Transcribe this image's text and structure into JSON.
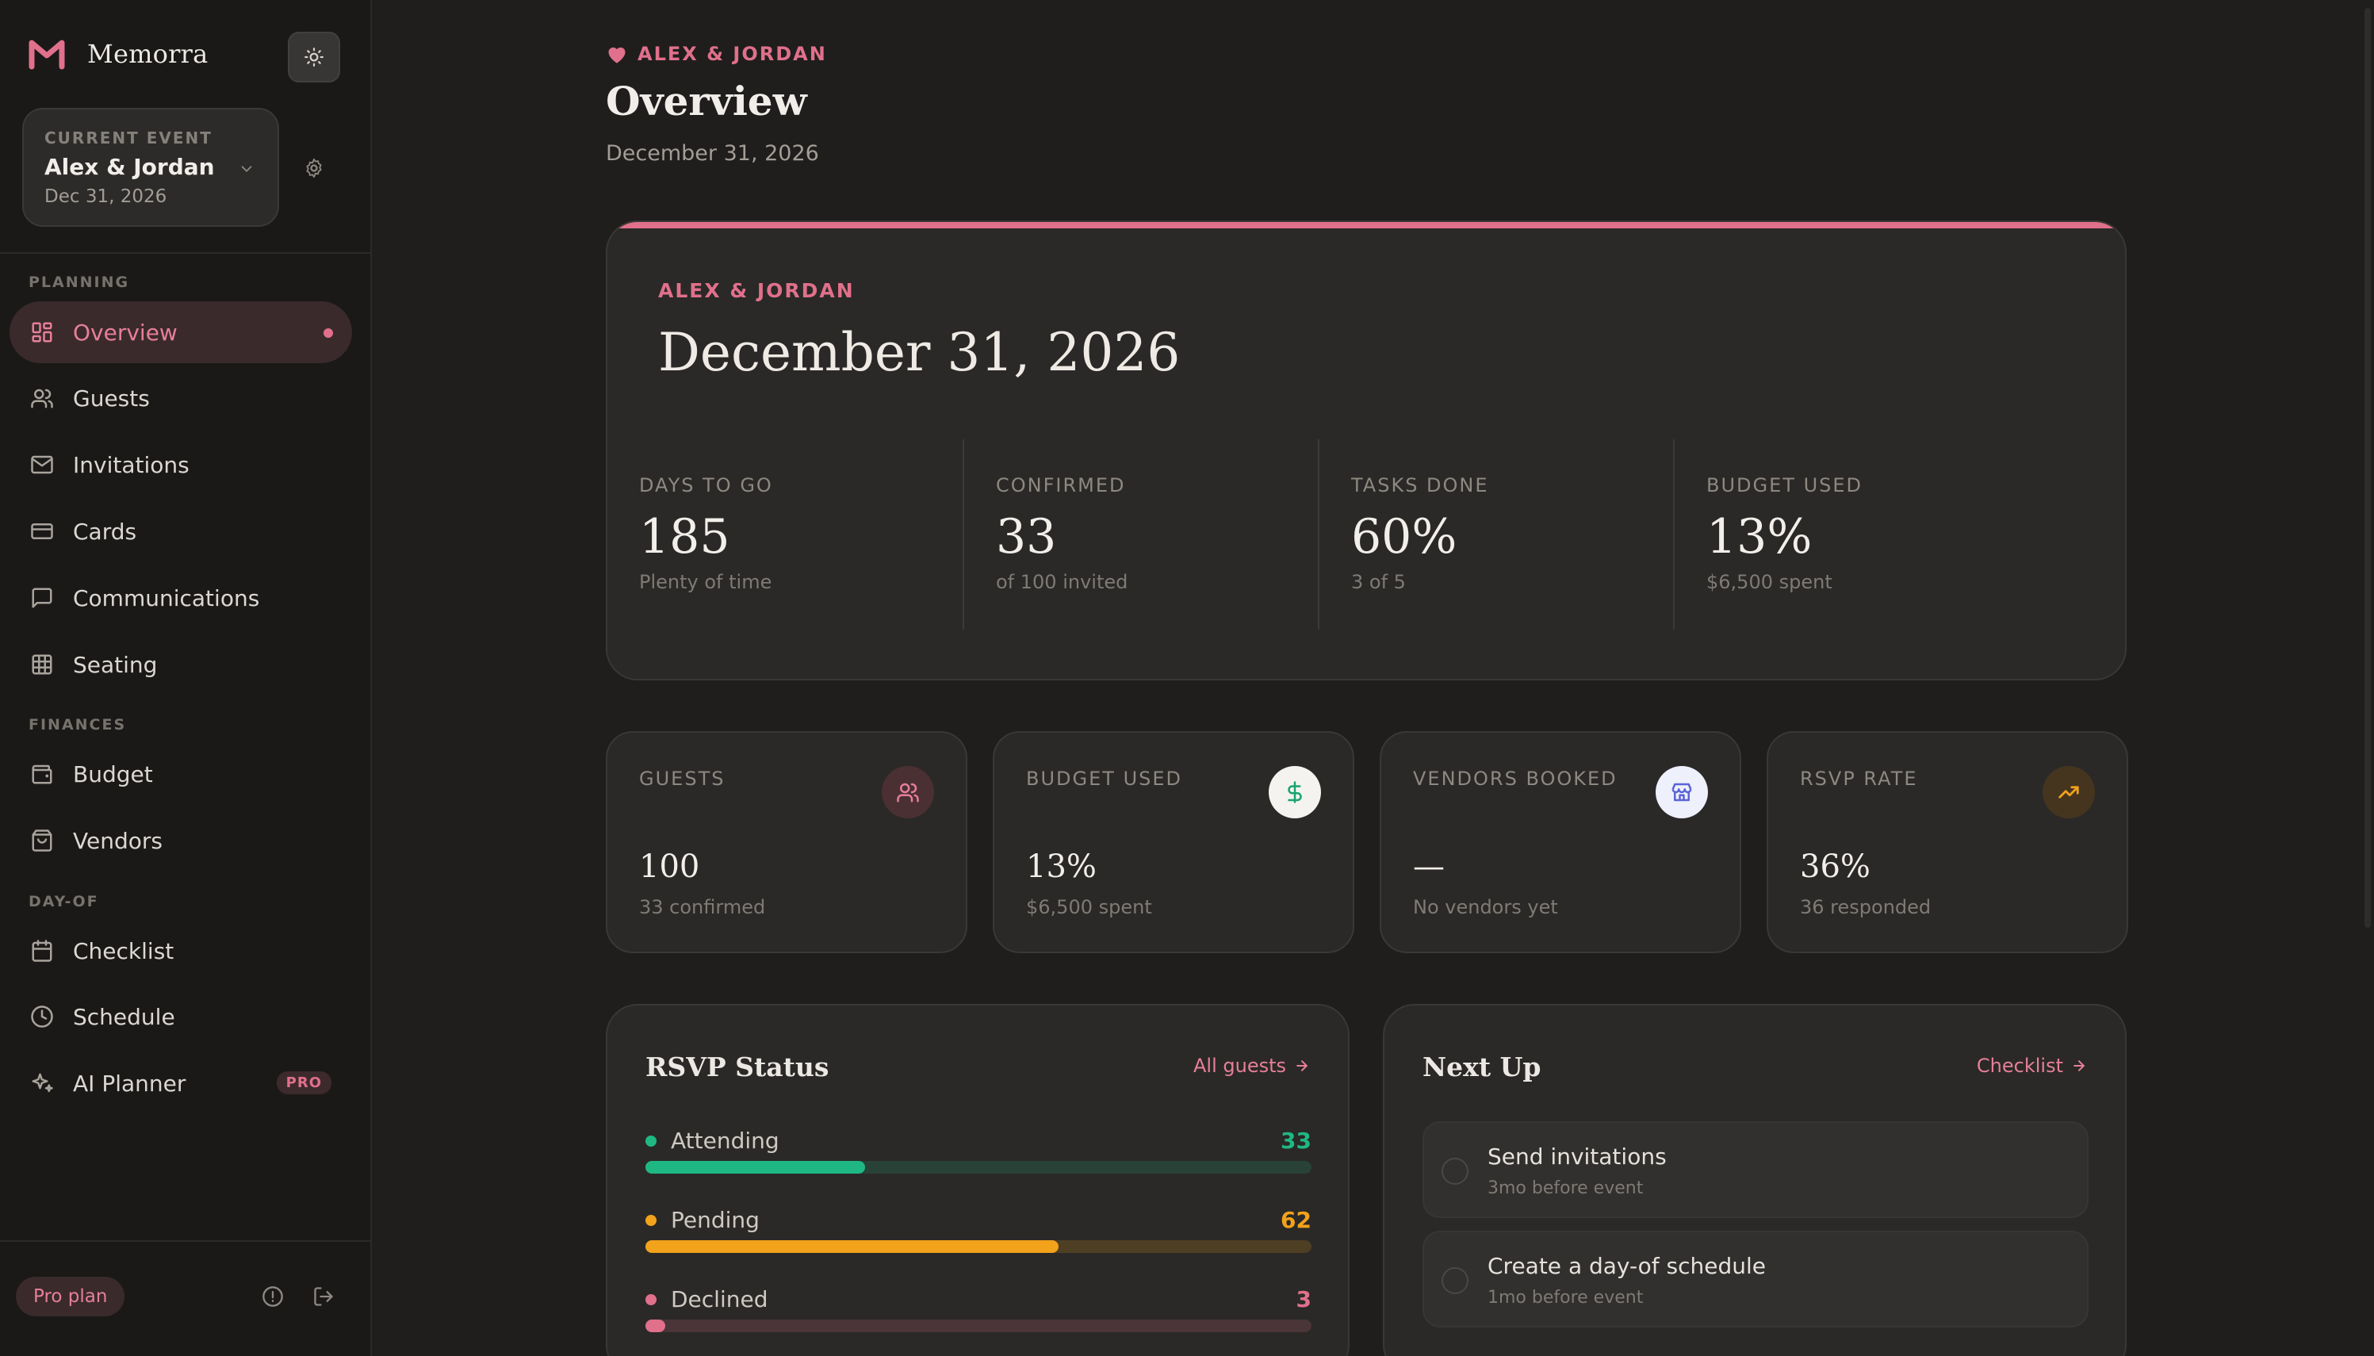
{
  "brand": {
    "name": "Memorra"
  },
  "current_event": {
    "kicker": "CURRENT EVENT",
    "name": "Alex & Jordan",
    "date": "Dec 31, 2026"
  },
  "sidebar": {
    "sections": {
      "planning": "PLANNING",
      "finances": "FINANCES",
      "dayof": "DAY-OF"
    },
    "items": [
      {
        "label": "Overview",
        "icon": "layout-grid-icon"
      },
      {
        "label": "Guests",
        "icon": "users-icon"
      },
      {
        "label": "Invitations",
        "icon": "mail-icon"
      },
      {
        "label": "Cards",
        "icon": "credit-card-icon"
      },
      {
        "label": "Communications",
        "icon": "message-icon"
      },
      {
        "label": "Seating",
        "icon": "table-grid-icon"
      },
      {
        "label": "Budget",
        "icon": "wallet-icon"
      },
      {
        "label": "Vendors",
        "icon": "shopping-bag-icon"
      },
      {
        "label": "Checklist",
        "icon": "calendar-icon"
      },
      {
        "label": "Schedule",
        "icon": "clock-icon"
      },
      {
        "label": "AI Planner",
        "icon": "sparkles-icon",
        "badge": "PRO"
      }
    ],
    "plan": "Pro plan"
  },
  "header": {
    "kicker": "ALEX & JORDAN",
    "title": "Overview",
    "date": "December 31, 2026"
  },
  "hero": {
    "kicker": "ALEX & JORDAN",
    "date": "December 31, 2026",
    "stats": [
      {
        "label": "DAYS TO GO",
        "value": "185",
        "sub": "Plenty of time"
      },
      {
        "label": "CONFIRMED",
        "value": "33",
        "sub": "of 100 invited"
      },
      {
        "label": "TASKS DONE",
        "value": "60%",
        "sub": "3 of 5"
      },
      {
        "label": "BUDGET USED",
        "value": "13%",
        "sub": "$6,500 spent"
      }
    ]
  },
  "cards": [
    {
      "label": "GUESTS",
      "value": "100",
      "sub": "33 confirmed",
      "icon": "users-icon"
    },
    {
      "label": "BUDGET USED",
      "value": "13%",
      "sub": "$6,500 spent",
      "icon": "dollar-icon"
    },
    {
      "label": "VENDORS BOOKED",
      "value": "—",
      "sub": "No vendors yet",
      "icon": "store-icon"
    },
    {
      "label": "RSVP RATE",
      "value": "36%",
      "sub": "36 responded",
      "icon": "trending-up-icon"
    }
  ],
  "rsvp": {
    "title": "RSVP Status",
    "link": "All guests",
    "total": 100,
    "rows": [
      {
        "label": "Attending",
        "count": 33,
        "color": "#1fb884"
      },
      {
        "label": "Pending",
        "count": 62,
        "color": "#f3a21b"
      },
      {
        "label": "Declined",
        "count": 3,
        "color": "#e0708b"
      }
    ]
  },
  "next_up": {
    "title": "Next Up",
    "link": "Checklist",
    "tasks": [
      {
        "title": "Send invitations",
        "sub": "3mo before event"
      },
      {
        "title": "Create a day-of schedule",
        "sub": "1mo before event"
      }
    ]
  },
  "colors": {
    "accent": "#e0708b",
    "attending": "#1fb884",
    "pending": "#f3a21b",
    "background": "#1f1e1d"
  }
}
